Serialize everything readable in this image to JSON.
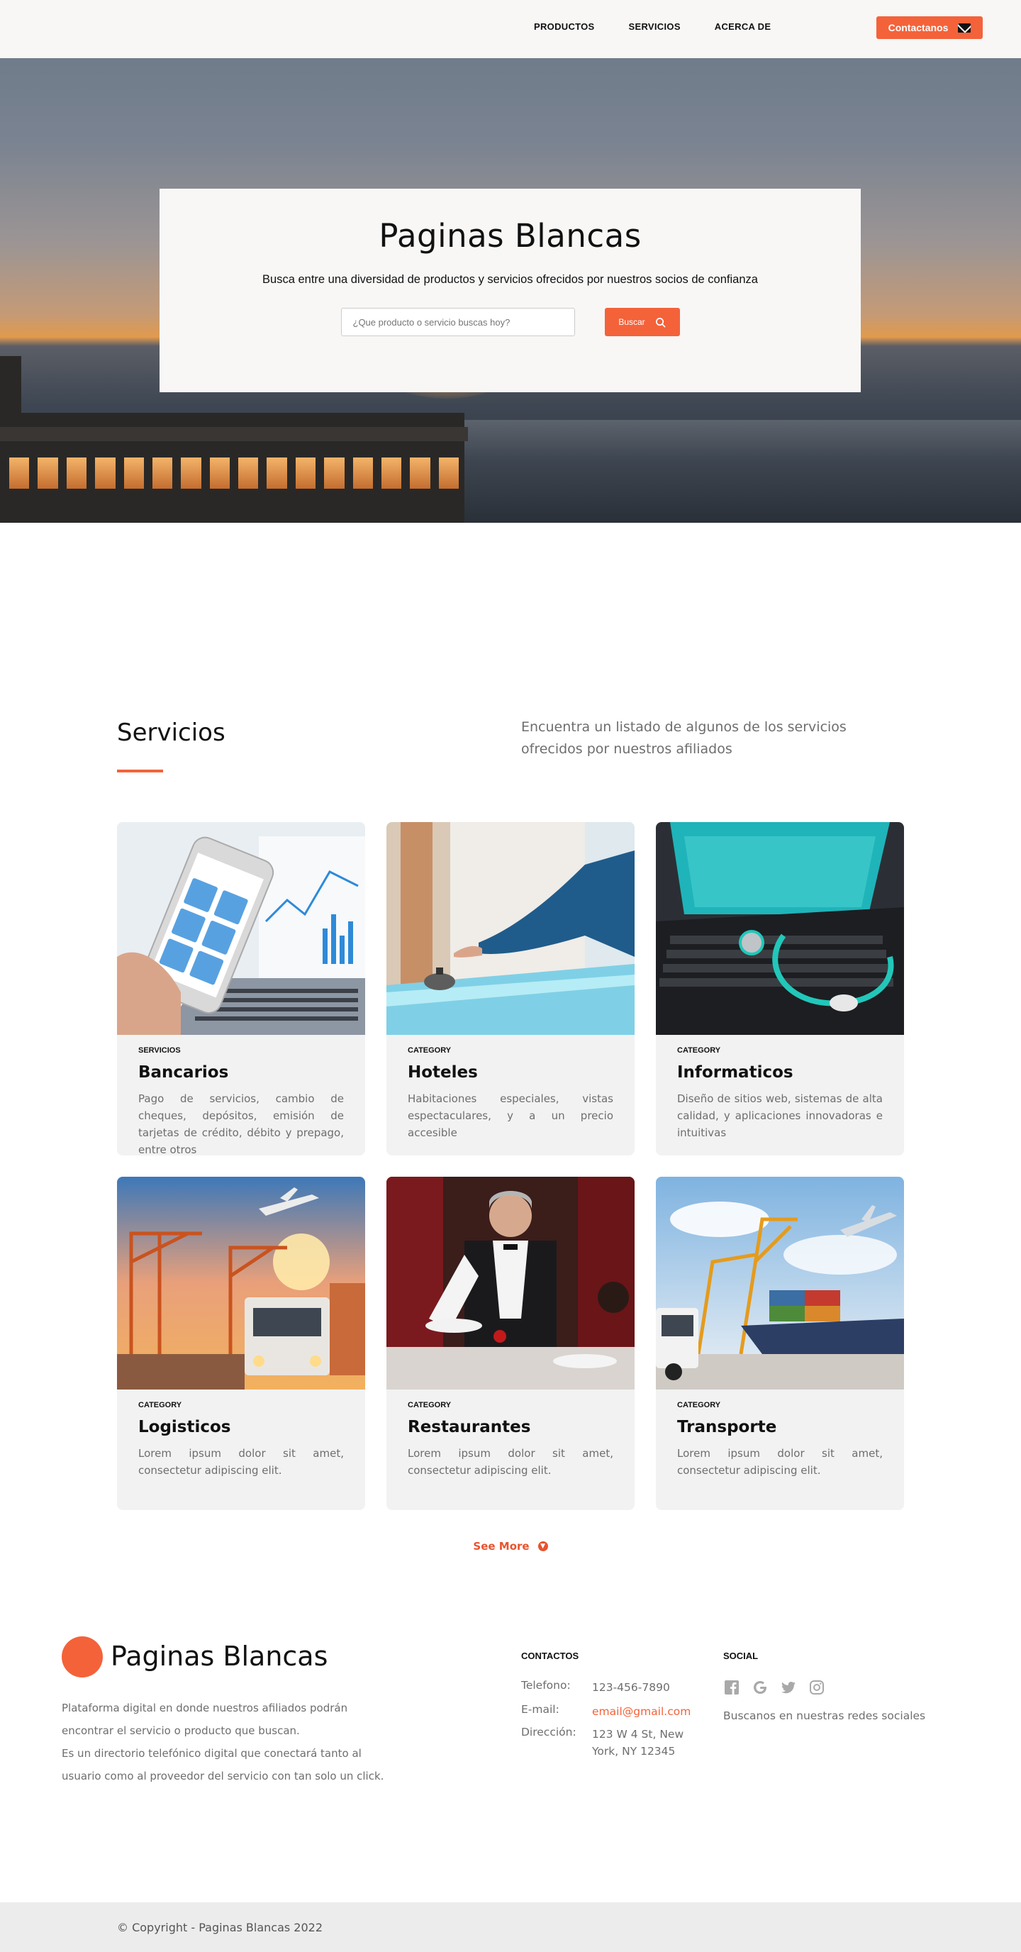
{
  "nav": {
    "links": [
      "PRODUCTOS",
      "SERVICIOS",
      "ACERCA DE"
    ],
    "contact_label": "Contactanos",
    "contact_icon": "mail-icon"
  },
  "hero": {
    "title": "Paginas Blancas",
    "subtitle": "Busca entre una diversidad de productos y servicios ofrecidos por nuestros socios de confianza",
    "search_placeholder": "¿Que producto o servicio buscas hoy?",
    "search_button": "Buscar",
    "search_icon": "search-icon"
  },
  "services": {
    "heading": "Servicios",
    "intro": "Encuentra un listado de algunos de los servicios ofrecidos por nuestros afiliados",
    "cards": [
      {
        "category": "SERVICIOS",
        "title": "Bancarios",
        "description": "Pago de servicios, cambio de cheques, depósitos, emisión de tarjetas de crédito, débito y prepago, entre otros"
      },
      {
        "category": "CATEGORY",
        "title": "Hoteles",
        "description": "Habitaciones especiales, vistas espectaculares, y a un precio accesible"
      },
      {
        "category": "CATEGORY",
        "title": "Informaticos",
        "description": "Diseño de sitios web, sistemas de alta calidad, y aplicaciones innovadoras e intuitivas"
      },
      {
        "category": "CATEGORY",
        "title": "Logisticos",
        "description": "Lorem ipsum dolor sit amet, consectetur adipiscing elit."
      },
      {
        "category": "CATEGORY",
        "title": "Restaurantes",
        "description": "Lorem ipsum dolor sit amet, consectetur adipiscing elit."
      },
      {
        "category": "CATEGORY",
        "title": "Transporte",
        "description": "Lorem ipsum dolor sit amet, consectetur adipiscing elit."
      }
    ],
    "see_more": "See More"
  },
  "footer": {
    "brand": "Paginas Blancas",
    "about_1": "Plataforma digital en donde nuestros afiliados podrán encontrar el servicio o producto que buscan.",
    "about_2": "Es un directorio telefónico digital que conectará tanto al usuario como al proveedor del servicio con tan solo un click.",
    "contacts_heading": "CONTACTOS",
    "phone_label": "Telefono:",
    "phone_value": "123-456-7890",
    "email_label": "E-mail:",
    "email_value": "email@gmail.com",
    "address_label": "Dirección:",
    "address_value": "123 W 4 St, New York, NY 12345",
    "social_heading": "SOCIAL",
    "social_icons": [
      "facebook-icon",
      "google-icon",
      "twitter-icon",
      "instagram-icon"
    ],
    "social_text": "Buscanos en nuestras redes sociales",
    "copyright": "© Copyright - Paginas Blancas 2022"
  },
  "colors": {
    "accent": "#f4623a",
    "nav_bg": "#f8f7f6",
    "card_bg": "#f2f2f2",
    "footer_bar": "#ececec"
  }
}
